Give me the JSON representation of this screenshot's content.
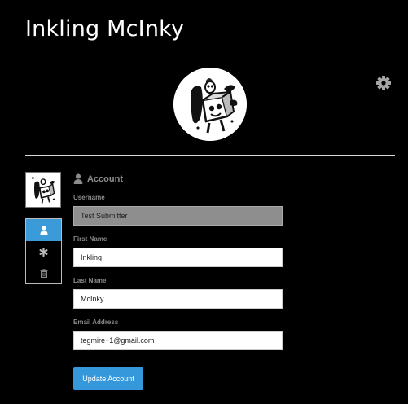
{
  "header": {
    "title": "Inkling McInky"
  },
  "icons": {
    "settings": "gear-icon",
    "account": "user-icon",
    "security": "asterisk-icon",
    "delete": "trash-icon"
  },
  "colors": {
    "accent": "#3b9bd9",
    "button": "#3498db",
    "background": "#000000"
  },
  "account": {
    "heading": "Account",
    "username": {
      "label": "Username",
      "value": "Test Submitter"
    },
    "first_name": {
      "label": "First Name",
      "value": "Inkling"
    },
    "last_name": {
      "label": "Last Name",
      "value": "McInky"
    },
    "email": {
      "label": "Email Address",
      "value": "tegmire+1@gmail.com"
    },
    "submit_label": "Update Account"
  }
}
